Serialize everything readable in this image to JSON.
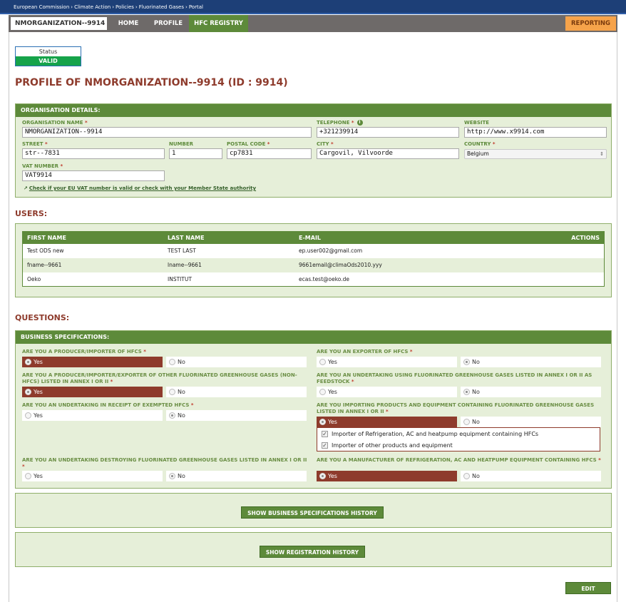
{
  "breadcrumb": [
    "European Commission",
    "Climate Action",
    "Policies",
    "Fluorinated Gases",
    "Portal"
  ],
  "nav": {
    "org": "NMORGANIZATION--9914",
    "home": "HOME",
    "profile": "PROFILE",
    "hfc_registry": "HFC REGISTRY",
    "reporting": "REPORTING"
  },
  "status": {
    "label": "Status",
    "value": "VALID"
  },
  "page_title": "PROFILE OF NMORGANIZATION--9914 (ID : 9914)",
  "org_details": {
    "heading": "ORGANISATION DETAILS:",
    "name_label": "ORGANISATION NAME",
    "name": "NMORGANIZATION--9914",
    "telephone_label": "TELEPHONE",
    "telephone": "+321239914",
    "website_label": "WEBSITE",
    "website": "http://www.x9914.com",
    "street_label": "STREET",
    "street": "str--7831",
    "number_label": "NUMBER",
    "number": "1",
    "postal_label": "POSTAL CODE",
    "postal": "cp7831",
    "city_label": "CITY",
    "city": "Cargovil, Vilvoorde",
    "country_label": "COUNTRY",
    "country": "Belgium",
    "vat_label": "VAT NUMBER",
    "vat": "VAT9914",
    "vat_link": "Check if your EU VAT number is valid or check with your Member State authority",
    "required_mark": "*"
  },
  "users": {
    "title": "USERS:",
    "columns": [
      "FIRST NAME",
      "LAST NAME",
      "E-MAIL",
      "ACTIONS"
    ],
    "rows": [
      {
        "first": "Test ODS new",
        "last": "TEST LAST",
        "email": "ep.user002@gmail.com"
      },
      {
        "first": "fname--9661",
        "last": "lname--9661",
        "email": "9661email@climaOds2010.yyy"
      },
      {
        "first": "Oeko",
        "last": "INSTITUT",
        "email": "ecas.test@oeko.de"
      }
    ]
  },
  "questions": {
    "title": "QUESTIONS:",
    "heading": "BUSINESS SPECIFICATIONS:",
    "yes": "Yes",
    "no": "No",
    "q1": "ARE YOU A PRODUCER/IMPORTER OF HFCS",
    "q2": "ARE YOU AN EXPORTER OF HFCS",
    "q3": "ARE YOU A PRODUCER/IMPORTER/EXPORTER OF OTHER FLUORINATED GREENHOUSE GASES (NON-HFCS) LISTED IN ANNEX I OR II",
    "q4": "ARE YOU AN UNDERTAKING USING FLUORINATED GREENHOUSE GASES LISTED IN ANNEX I OR II AS FEEDSTOCK",
    "q5": "ARE YOU AN UNDERTAKING IN RECEIPT OF EXEMPTED HFCS",
    "q6": "ARE YOU IMPORTING PRODUCTS AND EQUIPMENT CONTAINING FLUORINATED GREENHOUSE GASES LISTED IN ANNEX I OR II",
    "q6_sub1": "Importer of Refrigeration, AC and heatpump equipment containing HFCs",
    "q6_sub2": "Importer of other products and equipment",
    "q7": "ARE YOU AN UNDERTAKING DESTROYING FLUORINATED GREENHOUSE GASES LISTED IN ANNEX I OR II",
    "q8": "ARE YOU A MANUFACTURER OF REFRIGERATION, AC AND HEATPUMP EQUIPMENT CONTAINING HFCS",
    "answers": {
      "q1": "Yes",
      "q2": "No",
      "q3": "Yes",
      "q4": "No",
      "q5": "No",
      "q6": "Yes",
      "q7": "No",
      "q8": "Yes"
    }
  },
  "buttons": {
    "business_history": "SHOW BUSINESS SPECIFICATIONS HISTORY",
    "registration_history": "SHOW REGISTRATION HISTORY",
    "edit": "EDIT"
  },
  "colors": {
    "accent_green": "#5d8a3a",
    "accent_red": "#8e3b2c",
    "top_blue": "#1d3f77",
    "reporting_orange": "#f6a34a",
    "valid_green": "#16a34a"
  },
  "icons": {
    "info": "info-icon",
    "external": "external-link-icon",
    "chevron": "chevron-right-icon",
    "select": "select-arrows-icon"
  }
}
